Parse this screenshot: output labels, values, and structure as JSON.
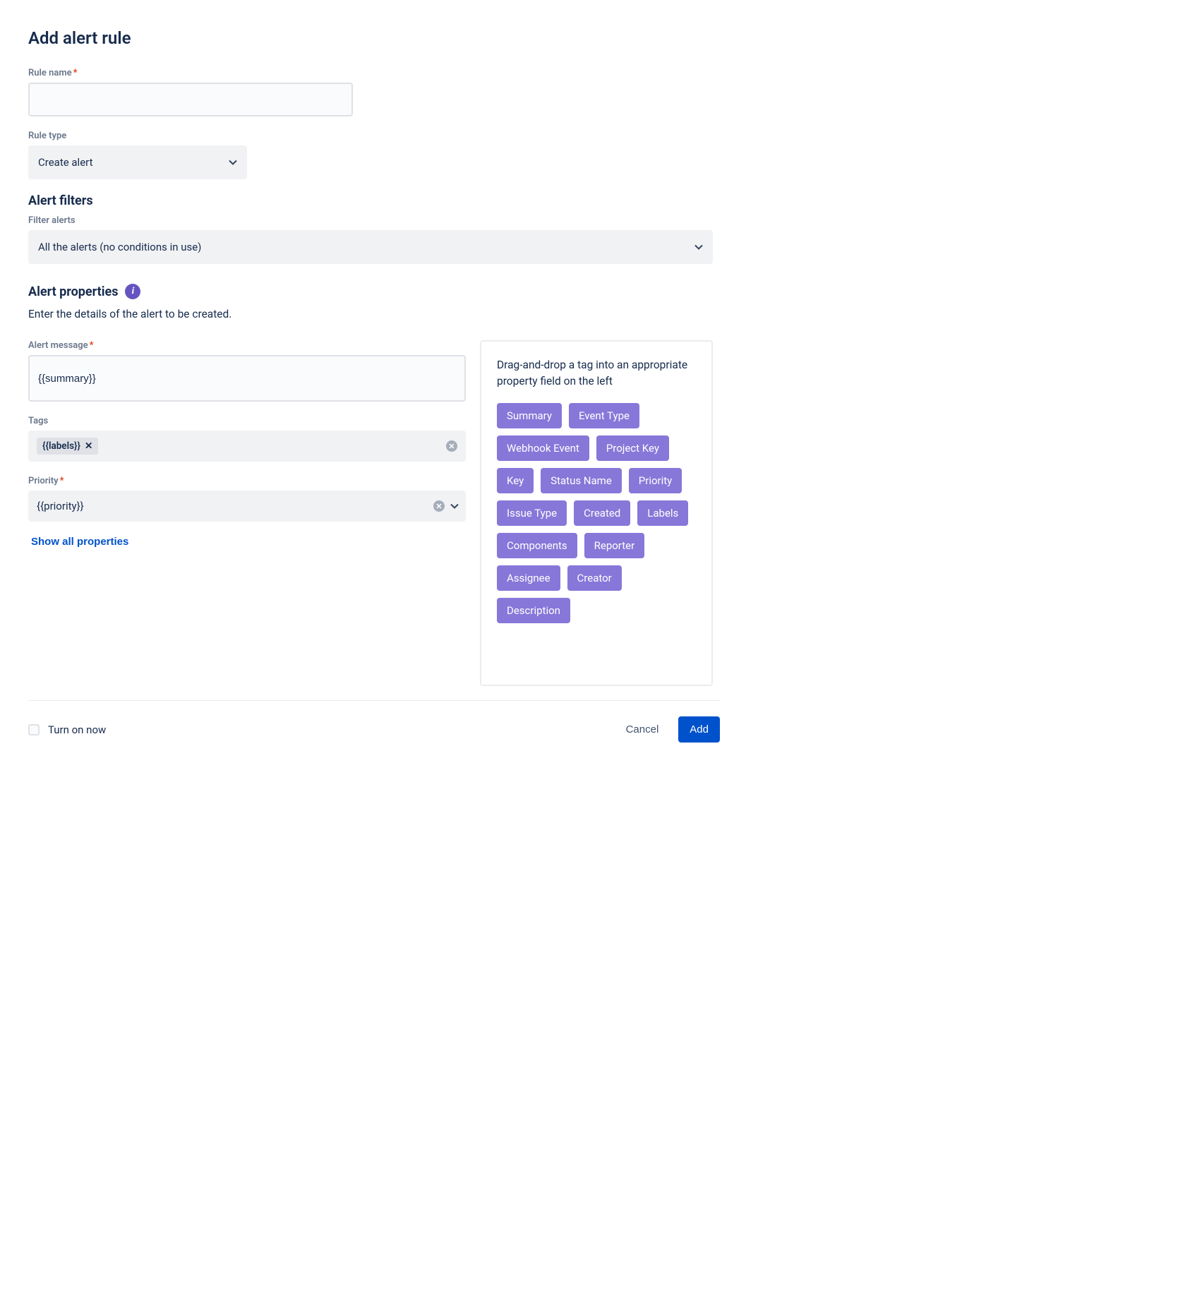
{
  "title": "Add alert rule",
  "ruleName": {
    "label": "Rule name",
    "required": true,
    "value": ""
  },
  "ruleType": {
    "label": "Rule type",
    "selected": "Create alert"
  },
  "alertFilters": {
    "heading": "Alert filters",
    "label": "Filter alerts",
    "selected": "All the alerts (no conditions in use)"
  },
  "alertProperties": {
    "heading": "Alert properties",
    "description": "Enter the details of the alert to be created."
  },
  "alertMessage": {
    "label": "Alert message",
    "required": true,
    "value": "{{summary}}"
  },
  "tagsField": {
    "label": "Tags",
    "chips": [
      "{{labels}}"
    ]
  },
  "priority": {
    "label": "Priority",
    "required": true,
    "value": "{{priority}}"
  },
  "showAllProperties": "Show all properties",
  "dragPanel": {
    "description": "Drag-and-drop a tag into an appropriate property field on the left",
    "tags": [
      "Summary",
      "Event Type",
      "Webhook Event",
      "Project Key",
      "Key",
      "Status Name",
      "Priority",
      "Issue Type",
      "Created",
      "Labels",
      "Components",
      "Reporter",
      "Assignee",
      "Creator",
      "Description"
    ]
  },
  "footer": {
    "turnLabel": "Turn on now",
    "cancel": "Cancel",
    "add": "Add"
  }
}
